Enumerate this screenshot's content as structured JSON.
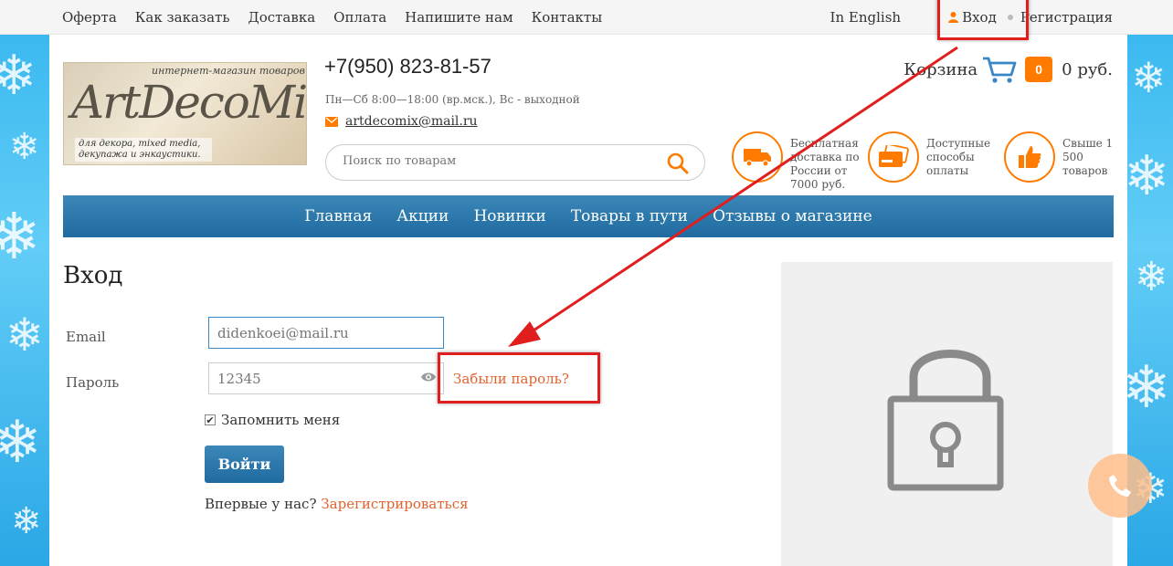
{
  "topbar": {
    "links": [
      "Оферта",
      "Как заказать",
      "Доставка",
      "Оплата",
      "Напишите нам",
      "Контакты"
    ],
    "lang": "In English",
    "login": "Вход",
    "register": "Регистрация"
  },
  "header": {
    "logo_tag": "интернет-магазин товаров",
    "logo_brand": "ArtDecoMix",
    "logo_sub": "для декора, mixed media, декупажа и энкаустики.",
    "phone": "+7(950) 823-81-57",
    "hours": "Пн—Сб 8:00—18:00 (вр.мск.), Вс - выходной",
    "email": "artdecomix@mail.ru",
    "search_placeholder": "Поиск по товарам",
    "cart_label": "Корзина",
    "cart_count": "0",
    "cart_sum": "0 руб.",
    "features": [
      {
        "icon": "truck-icon",
        "text": "Бесплатная доставка по России от 7000 руб."
      },
      {
        "icon": "credit-card-icon",
        "text": "Доступные способы оплаты"
      },
      {
        "icon": "thumbs-up-icon",
        "text": "Свыше 1 500 товаров"
      }
    ]
  },
  "nav": [
    "Главная",
    "Акции",
    "Новинки",
    "Товары в пути",
    "Отзывы о магазине"
  ],
  "login_form": {
    "title": "Вход",
    "email_label": "Email",
    "email_value": "didenkoei@mail.ru",
    "password_label": "Пароль",
    "password_value": "12345",
    "forgot": "Забыли пароль?",
    "remember": "Запомнить меня",
    "submit": "Войти",
    "first_time": "Впервые у нас?",
    "register_link": "Зарегистрироваться"
  },
  "colors": {
    "accent": "#ff7b00",
    "link": "#e0632e",
    "nav": "#2a76aa",
    "annotation": "#e01e1e"
  }
}
